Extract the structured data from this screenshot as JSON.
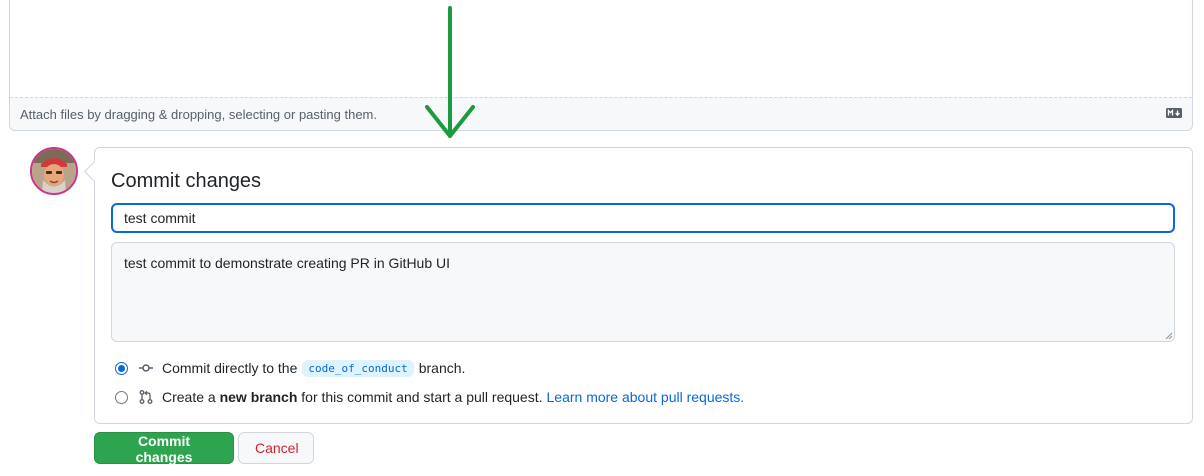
{
  "editor": {
    "attach_text": "Attach files by dragging & dropping, selecting or pasting them.",
    "markdown_icon": "markdown-icon"
  },
  "annotation": {
    "arrow_color": "#1a9c3e",
    "icon": "down-arrow-annotation"
  },
  "commit": {
    "title": "Commit changes",
    "summary_value": "test commit",
    "description_value": "test commit to demonstrate creating PR in GitHub UI",
    "option_direct": {
      "checked": true,
      "icon": "git-commit-icon",
      "text_before": "Commit directly to the",
      "branch": "code_of_conduct",
      "text_after": "branch."
    },
    "option_new_branch": {
      "checked": false,
      "icon": "git-pull-request-icon",
      "text_before": "Create a",
      "bold": "new branch",
      "text_after": "for this commit and start a pull request.",
      "link": "Learn more about pull requests."
    }
  },
  "buttons": {
    "commit_label": "Commit changes",
    "cancel_label": "Cancel"
  },
  "colors": {
    "accent": "#0969da",
    "primary_button": "#2da44e",
    "danger": "#cf222e"
  }
}
